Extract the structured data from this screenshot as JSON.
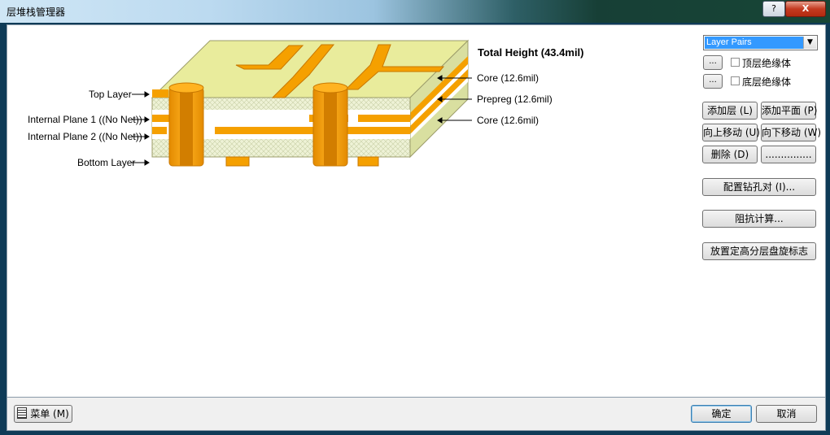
{
  "window": {
    "title": "层堆栈管理器",
    "help_label": "?",
    "close_label": "X"
  },
  "stack": {
    "total_height": "Total Height (43.4mil)",
    "left_labels": [
      "Top Layer",
      "Internal Plane 1 ((No Net))",
      "Internal Plane 2 ((No Net))",
      "Bottom Layer"
    ],
    "right_labels": [
      "Core (12.6mil)",
      "Prepreg (12.6mil)",
      "Core (12.6mil)"
    ]
  },
  "panel": {
    "dropdown_value": "Layer Pairs",
    "dots_label": "...",
    "top_dielectric": "顶层绝缘体",
    "bottom_dielectric": "底层绝缘体",
    "add_layer": "添加层 (L)",
    "add_plane": "添加平面 (P)",
    "move_up": "向上移动 (U)",
    "move_down": "向下移动 (W)",
    "delete": "删除 (D)",
    "properties": "...............",
    "drill_pairs": "配置钻孔对 (I)...",
    "impedance": "阻抗计算...",
    "place_legend": "放置定高分层盘旋标志"
  },
  "footer": {
    "menu_label": "菜单 (M)",
    "ok_label": "确定",
    "cancel_label": "取消"
  },
  "colors": {
    "copper": "#f5a000",
    "substrate": "#e6eec0",
    "top_surface": "#e9ec9c",
    "dialog_bg": "#f0f0f0"
  }
}
